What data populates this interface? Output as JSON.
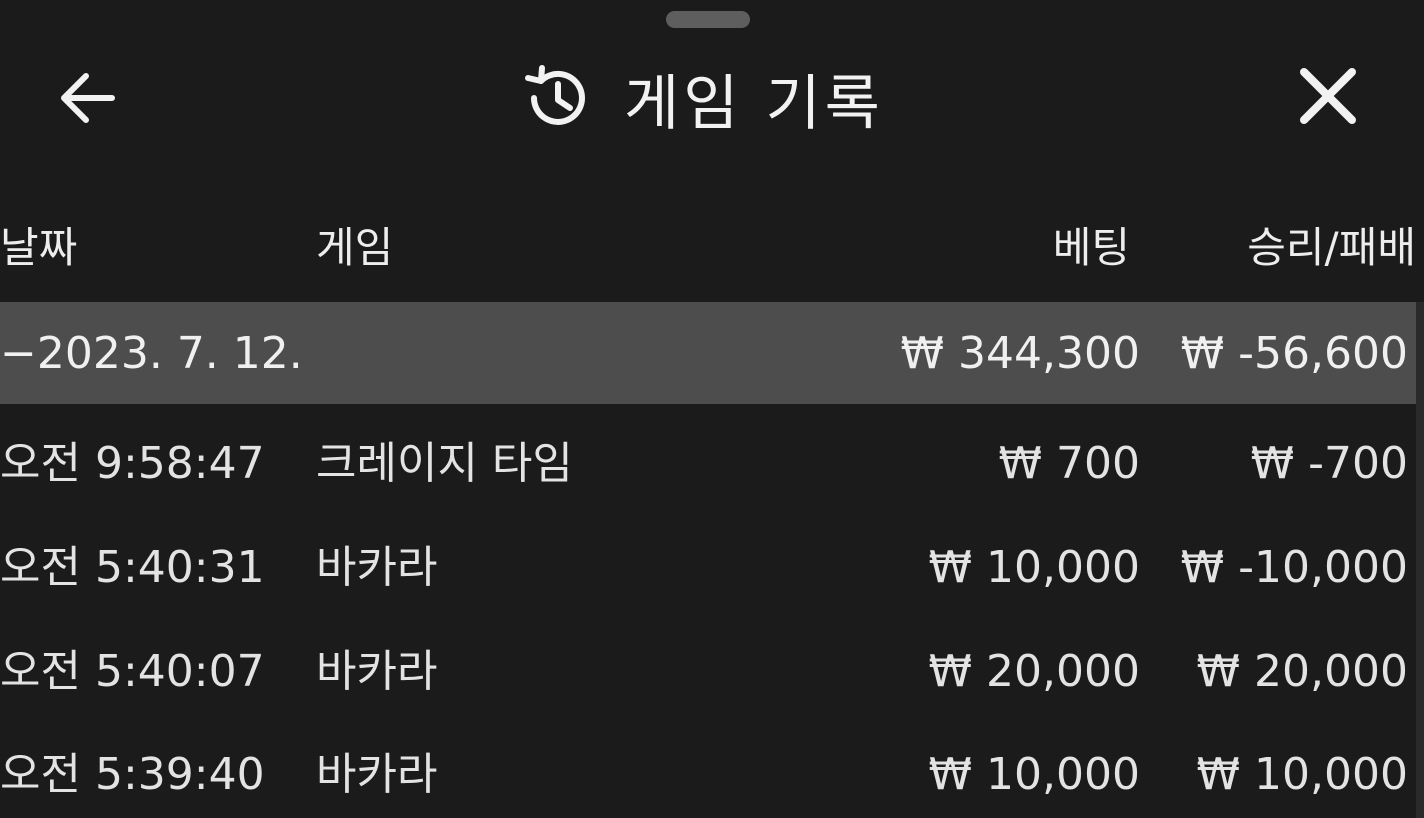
{
  "header": {
    "title": "게임 기록",
    "back_icon": "arrow-left-icon",
    "history_icon": "history-icon",
    "close_icon": "close-icon"
  },
  "table": {
    "columns": [
      "날짜",
      "게임",
      "베팅",
      "승리/패배"
    ],
    "summary": {
      "date": "−2023. 7. 12.",
      "bet": "₩ 344,300",
      "win_loss": "₩ -56,600"
    },
    "rows": [
      {
        "time": "오전 9:58:47",
        "game": "크레이지 타임",
        "bet": "₩ 700",
        "win_loss": "₩ -700"
      },
      {
        "time": "오전 5:40:31",
        "game": "바카라",
        "bet": "₩ 10,000",
        "win_loss": "₩ -10,000"
      },
      {
        "time": "오전 5:40:07",
        "game": "바카라",
        "bet": "₩ 20,000",
        "win_loss": "₩ 20,000"
      },
      {
        "time": "오전 5:39:40",
        "game": "바카라",
        "bet": "₩ 10,000",
        "win_loss": "₩ 10,000"
      }
    ]
  },
  "colors": {
    "background": "#1b1b1b",
    "summary_row": "#4d4d4d",
    "text": "#e6e6e6"
  }
}
